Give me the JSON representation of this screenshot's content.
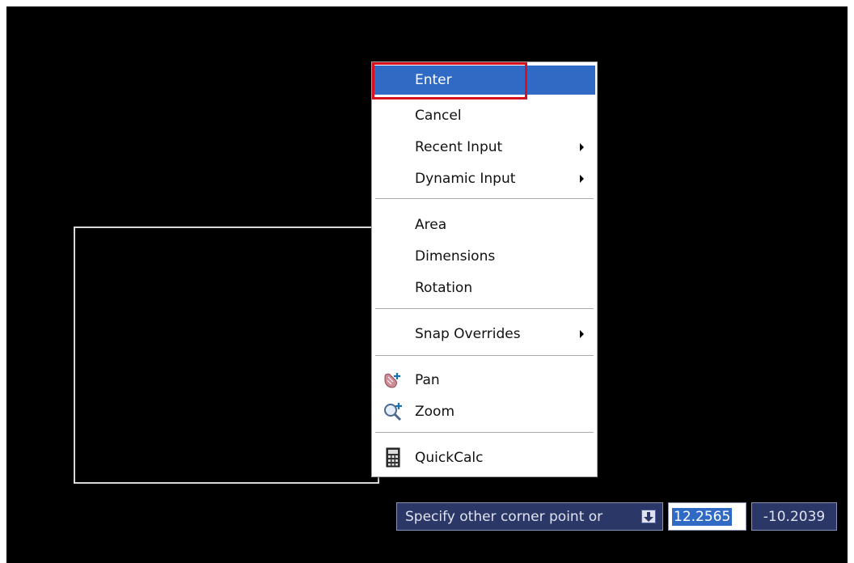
{
  "context_menu": {
    "items": [
      {
        "label": "Enter",
        "highlighted": true,
        "submenu": false
      },
      {
        "label": "Cancel",
        "submenu": false
      },
      {
        "label": "Recent Input",
        "submenu": true
      },
      {
        "label": "Dynamic Input",
        "submenu": true
      },
      {
        "label": "Area",
        "submenu": false
      },
      {
        "label": "Dimensions",
        "submenu": false
      },
      {
        "label": "Rotation",
        "submenu": false
      },
      {
        "label": "Snap Overrides",
        "submenu": true
      },
      {
        "label": "Pan",
        "icon": "pan-icon",
        "submenu": false
      },
      {
        "label": "Zoom",
        "icon": "zoom-icon",
        "submenu": false
      },
      {
        "label": "QuickCalc",
        "icon": "calculator-icon",
        "submenu": false
      }
    ]
  },
  "command_prompt": {
    "text": "Specify other corner point or",
    "options_icon": "down-arrow-icon"
  },
  "coordinates": {
    "x": "12.2565",
    "y": "-10.2039"
  },
  "colors": {
    "canvas_background": "#000000",
    "menu_highlight": "#316ac5",
    "annotation_box": "#d7101f",
    "prompt_background": "#2b3766"
  }
}
